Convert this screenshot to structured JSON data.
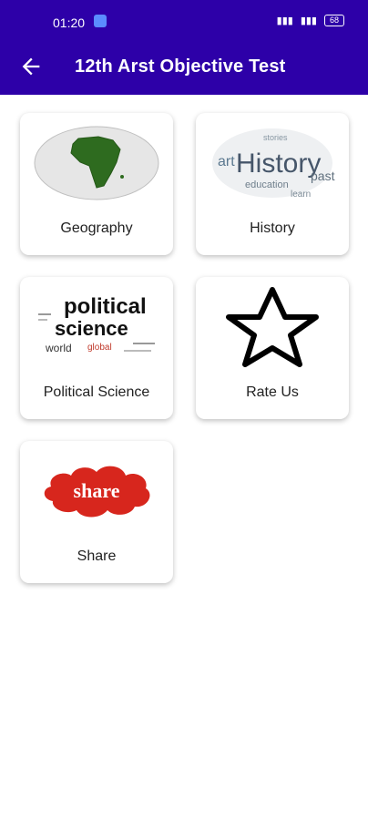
{
  "status_bar": {
    "time": "01:20",
    "battery": "68"
  },
  "app_bar": {
    "title": "12th Arst Objective Test"
  },
  "grid": {
    "items": [
      {
        "label": "Geography",
        "icon": "globe-africa-icon"
      },
      {
        "label": "History",
        "icon": "history-wordcloud-icon"
      },
      {
        "label": "Political Science",
        "icon": "political-science-wordcloud-icon"
      },
      {
        "label": "Rate Us",
        "icon": "star-outline-icon"
      },
      {
        "label": "Share",
        "icon": "share-cloud-icon"
      }
    ]
  },
  "images": {
    "history_words": [
      "History",
      "art",
      "past",
      "education",
      "learn",
      "stories"
    ],
    "polsci_words": [
      "political",
      "science",
      "world",
      "global"
    ],
    "share_text": "share"
  },
  "colors": {
    "appbar": "#2d00a8",
    "share_red": "#d7261d",
    "map_green": "#2e6b1f"
  }
}
